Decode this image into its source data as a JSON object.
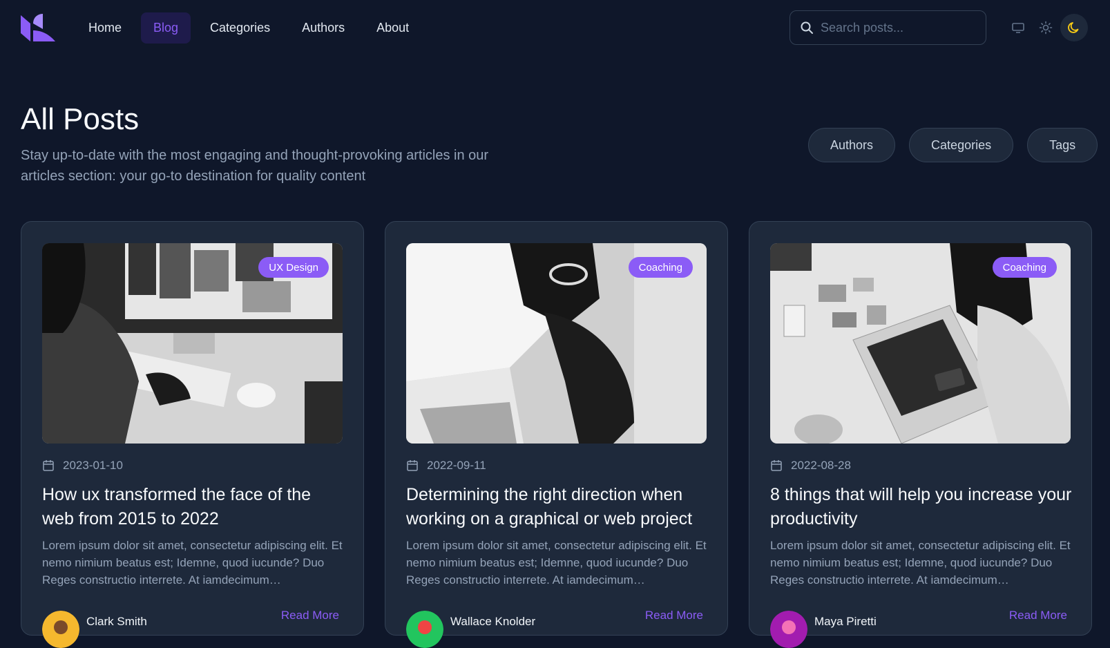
{
  "nav": {
    "links": [
      {
        "label": "Home"
      },
      {
        "label": "Blog"
      },
      {
        "label": "Categories"
      },
      {
        "label": "Authors"
      },
      {
        "label": "About"
      }
    ],
    "active_index": 1,
    "search_placeholder": "Search posts..."
  },
  "header": {
    "title": "All Posts",
    "description": "Stay up-to-date with the most engaging and thought-provoking articles in our articles section: your go-to destination for quality content",
    "filters": [
      "Authors",
      "Categories",
      "Tags"
    ]
  },
  "posts": [
    {
      "category": "UX Design",
      "date": "2023-01-10",
      "title": "How ux transformed the face of the web from 2015 to 2022",
      "excerpt": "Lorem ipsum dolor sit amet, consectetur adipiscing elit. Et nemo nimium beatus est; Idemne, quod iucunde? Duo Reges constructio interrete. At iamdecimum…",
      "author": "Clark Smith",
      "read_more": "Read More"
    },
    {
      "category": "Coaching",
      "date": "2022-09-11",
      "title": "Determining the right direction when working on a graphical or web project",
      "excerpt": "Lorem ipsum dolor sit amet, consectetur adipiscing elit. Et nemo nimium beatus est; Idemne, quod iucunde? Duo Reges constructio interrete. At iamdecimum…",
      "author": "Wallace Knolder",
      "read_more": "Read More"
    },
    {
      "category": "Coaching",
      "date": "2022-08-28",
      "title": "8 things that will help you increase your productivity",
      "excerpt": "Lorem ipsum dolor sit amet, consectetur adipiscing elit. Et nemo nimium beatus est; Idemne, quod iucunde? Duo Reges constructio interrete. At iamdecimum…",
      "author": "Maya Piretti",
      "read_more": "Read More"
    }
  ],
  "colors": {
    "background": "#0f172a",
    "card": "#1e293b",
    "accent": "#8b5cf6",
    "theme_moon": "#facc15"
  }
}
